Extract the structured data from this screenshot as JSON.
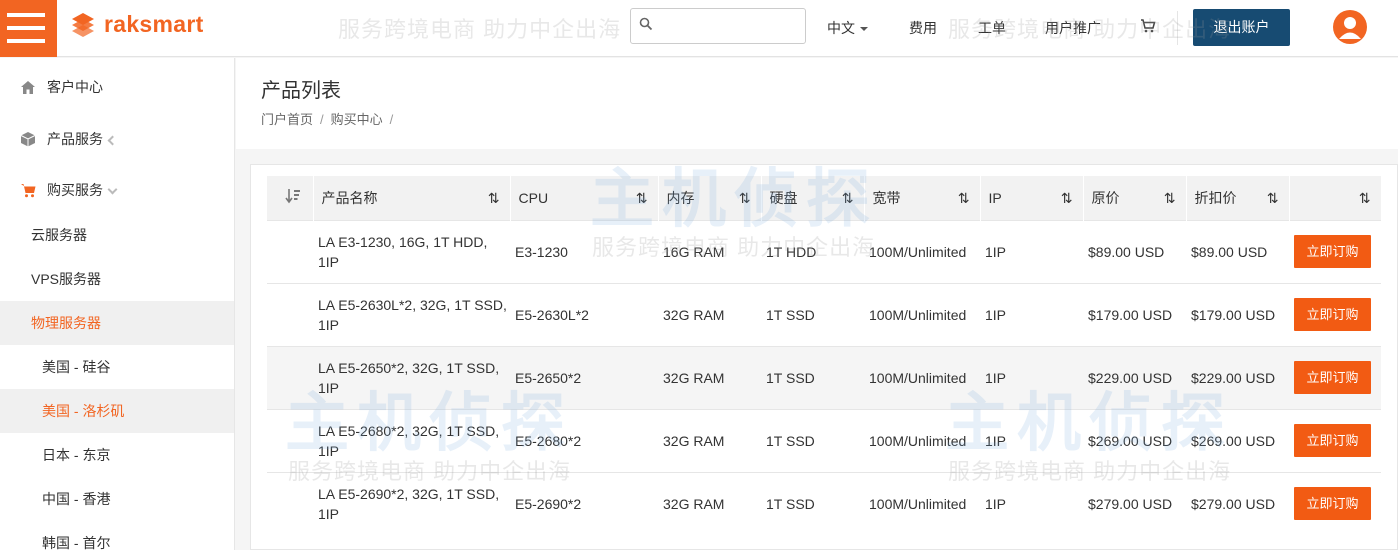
{
  "header": {
    "logo_text": "raksmart",
    "search_placeholder": "",
    "nav": [
      {
        "label": "中文"
      },
      {
        "label": "费用"
      },
      {
        "label": "工单"
      },
      {
        "label": "用户推广"
      }
    ],
    "logout_label": "退出账户",
    "accent_color": "#f26522",
    "logout_color": "#174b72"
  },
  "sidebar": {
    "top_items": [
      {
        "label": "客户中心",
        "icon": "home-icon"
      },
      {
        "label": "产品服务",
        "icon": "box-icon"
      },
      {
        "label": "购买服务",
        "icon": "cart-icon"
      }
    ],
    "sub_items": [
      {
        "label": "云服务器"
      },
      {
        "label": "VPS服务器"
      },
      {
        "label": "物理服务器"
      }
    ],
    "regions": [
      {
        "label": "美国 - 硅谷"
      },
      {
        "label": "美国 - 洛杉矶"
      },
      {
        "label": "日本 - 东京"
      },
      {
        "label": "中国 - 香港"
      },
      {
        "label": "韩国 - 首尔"
      }
    ]
  },
  "main": {
    "title": "产品列表",
    "breadcrumb": [
      "门户首页",
      "购买中心"
    ],
    "table": {
      "columns": [
        "",
        "产品名称",
        "CPU",
        "内存",
        "硬盘",
        "宽带",
        "IP",
        "原价",
        "折扣价",
        ""
      ],
      "order_label": "立即订购",
      "rows": [
        {
          "name": "LA E3-1230, 16G, 1T HDD, 1IP",
          "cpu": "E3-1230",
          "ram": "16G RAM",
          "disk": "1T HDD",
          "bandwidth": "100M/Unlimited",
          "ip": "1IP",
          "price": "$89.00 USD",
          "discount": "$89.00 USD"
        },
        {
          "name": "LA E5-2630L*2, 32G, 1T SSD, 1IP",
          "cpu": "E5-2630L*2",
          "ram": "32G RAM",
          "disk": "1T SSD",
          "bandwidth": "100M/Unlimited",
          "ip": "1IP",
          "price": "$179.00 USD",
          "discount": "$179.00 USD"
        },
        {
          "name": "LA E5-2650*2, 32G, 1T SSD, 1IP",
          "cpu": "E5-2650*2",
          "ram": "32G RAM",
          "disk": "1T SSD",
          "bandwidth": "100M/Unlimited",
          "ip": "1IP",
          "price": "$229.00 USD",
          "discount": "$229.00 USD"
        },
        {
          "name": "LA E5-2680*2, 32G, 1T SSD, 1IP",
          "cpu": "E5-2680*2",
          "ram": "32G RAM",
          "disk": "1T SSD",
          "bandwidth": "100M/Unlimited",
          "ip": "1IP",
          "price": "$269.00 USD",
          "discount": "$269.00 USD"
        },
        {
          "name": "LA E5-2690*2, 32G, 1T SSD, 1IP",
          "cpu": "E5-2690*2",
          "ram": "32G RAM",
          "disk": "1T SSD",
          "bandwidth": "100M/Unlimited",
          "ip": "1IP",
          "price": "$279.00 USD",
          "discount": "$279.00 USD"
        }
      ]
    }
  },
  "watermark": {
    "slogan": "服务跨境电商 助力中企出海",
    "brand": "主机侦探"
  }
}
